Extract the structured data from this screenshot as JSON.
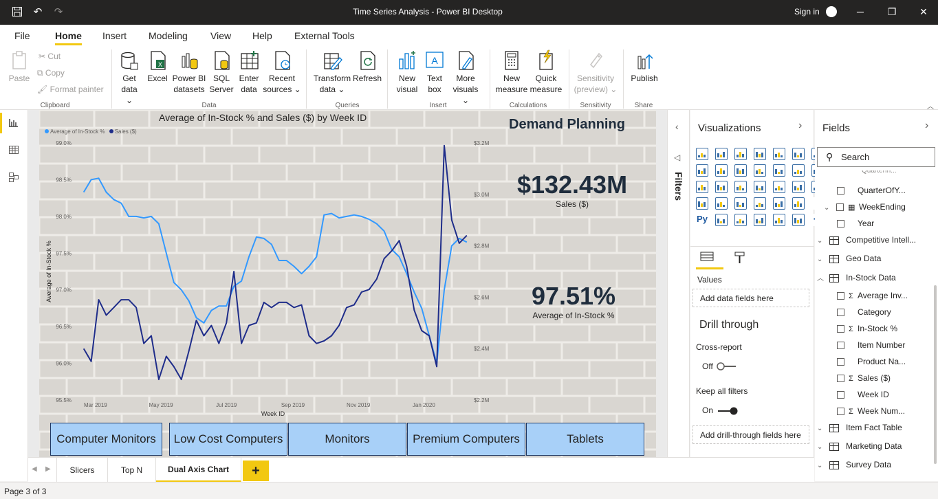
{
  "window": {
    "title": "Time Series Analysis - Power BI Desktop",
    "sign_in": "Sign in"
  },
  "menu": [
    "File",
    "Home",
    "Insert",
    "Modeling",
    "View",
    "Help",
    "External Tools"
  ],
  "ribbon": {
    "clipboard": {
      "paste": "Paste",
      "cut": "Cut",
      "copy": "Copy",
      "format_painter": "Format painter",
      "group": "Clipboard"
    },
    "data": {
      "get_data": [
        "Get",
        "data ⌄"
      ],
      "excel": "Excel",
      "pbi_datasets": [
        "Power BI",
        "datasets"
      ],
      "sql": [
        "SQL",
        "Server"
      ],
      "enter_data": [
        "Enter",
        "data"
      ],
      "recent": [
        "Recent",
        "sources ⌄"
      ],
      "group": "Data"
    },
    "queries": {
      "transform": [
        "Transform",
        "data ⌄"
      ],
      "refresh": "Refresh",
      "group": "Queries"
    },
    "insert": {
      "new_visual": [
        "New",
        "visual"
      ],
      "text_box": [
        "Text",
        "box"
      ],
      "more_visuals": [
        "More",
        "visuals ⌄"
      ],
      "group": "Insert"
    },
    "calculations": {
      "new_measure": [
        "New",
        "measure"
      ],
      "quick_measure": [
        "Quick",
        "measure"
      ],
      "group": "Calculations"
    },
    "sensitivity": {
      "label": [
        "Sensitivity",
        "(preview) ⌄"
      ],
      "group": "Sensitivity"
    },
    "share": {
      "publish": "Publish",
      "group": "Share"
    }
  },
  "report": {
    "chart_title": "Average of In-Stock % and Sales ($) by Week ID",
    "heading": "Demand Planning",
    "kpi_sales": {
      "value": "$132.43M",
      "label": "Sales ($)"
    },
    "kpi_instock": {
      "value": "97.51%",
      "label": "Average of In-Stock %"
    },
    "slicers": [
      "Computer Monitors",
      "Low Cost Computers",
      "Monitors",
      "Premium Computers",
      "Tablets"
    ]
  },
  "chart_data": {
    "type": "line",
    "title": "Average of In-Stock % and Sales ($) by Week ID",
    "xlabel": "Week ID",
    "ylabel": "Average of In-Stock %",
    "x_ticks": [
      "Mar 2019",
      "May 2019",
      "Jul 2019",
      "Sep 2019",
      "Nov 2019",
      "Jan 2020"
    ],
    "y_ticks": [
      "99.0%",
      "98.5%",
      "98.0%",
      "97.5%",
      "97.0%",
      "96.5%",
      "96.0%",
      "95.5%"
    ],
    "y2_ticks": [
      "$3.2M",
      "$3.0M",
      "$2.8M",
      "$2.6M",
      "$2.4M",
      "$2.2M"
    ],
    "ylim": [
      95.5,
      99.0
    ],
    "y2lim": [
      2.2,
      3.2
    ],
    "legend_position": "top-left",
    "series": [
      {
        "name": "Average of In-Stock %",
        "axis": "left",
        "color": "#3399ff",
        "x": [
          "2019-02-18",
          "2019-02-25",
          "2019-03-04",
          "2019-03-11",
          "2019-03-18",
          "2019-03-25",
          "2019-04-01",
          "2019-04-08",
          "2019-04-15",
          "2019-04-22",
          "2019-04-29",
          "2019-05-06",
          "2019-05-13",
          "2019-05-20",
          "2019-05-27",
          "2019-06-03",
          "2019-06-10",
          "2019-06-17",
          "2019-06-24",
          "2019-07-01",
          "2019-07-08",
          "2019-07-15",
          "2019-07-22",
          "2019-07-29",
          "2019-08-05",
          "2019-08-12",
          "2019-08-19",
          "2019-08-26",
          "2019-09-02",
          "2019-09-09",
          "2019-09-16",
          "2019-09-23",
          "2019-09-30",
          "2019-10-07",
          "2019-10-14",
          "2019-10-21",
          "2019-10-28",
          "2019-11-04",
          "2019-11-11",
          "2019-11-18",
          "2019-11-25",
          "2019-12-02",
          "2019-12-09",
          "2019-12-16",
          "2019-12-23",
          "2019-12-30",
          "2020-01-06",
          "2020-01-13",
          "2020-01-20",
          "2020-01-27",
          "2020-02-03",
          "2020-02-10"
        ],
        "y": [
          98.33,
          98.5,
          98.52,
          98.33,
          98.23,
          98.18,
          98.0,
          98.0,
          97.98,
          98.0,
          97.9,
          97.5,
          97.1,
          97.0,
          96.85,
          96.62,
          96.55,
          96.72,
          96.78,
          96.78,
          97.05,
          97.12,
          97.45,
          97.72,
          97.7,
          97.62,
          97.4,
          97.4,
          97.32,
          97.22,
          97.32,
          97.45,
          98.02,
          98.04,
          97.98,
          98.0,
          98.02,
          98.0,
          97.96,
          97.9,
          97.8,
          97.55,
          97.45,
          97.22,
          96.97,
          96.75,
          96.38,
          96.0,
          97.0,
          97.6,
          97.7,
          97.65
        ]
      },
      {
        "name": "Sales ($)",
        "axis": "right",
        "color": "#1f2d8a",
        "x": [
          "2019-02-18",
          "2019-02-25",
          "2019-03-04",
          "2019-03-11",
          "2019-03-18",
          "2019-03-25",
          "2019-04-01",
          "2019-04-08",
          "2019-04-15",
          "2019-04-22",
          "2019-04-29",
          "2019-05-06",
          "2019-05-13",
          "2019-05-20",
          "2019-05-27",
          "2019-06-03",
          "2019-06-10",
          "2019-06-17",
          "2019-06-24",
          "2019-07-01",
          "2019-07-08",
          "2019-07-15",
          "2019-07-22",
          "2019-07-29",
          "2019-08-05",
          "2019-08-12",
          "2019-08-19",
          "2019-08-26",
          "2019-09-02",
          "2019-09-09",
          "2019-09-16",
          "2019-09-23",
          "2019-09-30",
          "2019-10-07",
          "2019-10-14",
          "2019-10-21",
          "2019-10-28",
          "2019-11-04",
          "2019-11-11",
          "2019-11-18",
          "2019-11-25",
          "2019-12-02",
          "2019-12-09",
          "2019-12-16",
          "2019-12-23",
          "2019-12-30",
          "2020-01-06",
          "2020-01-13",
          "2020-01-20",
          "2020-01-27",
          "2020-02-03",
          "2020-02-10"
        ],
        "y": [
          2.4,
          2.35,
          2.59,
          2.53,
          2.56,
          2.59,
          2.59,
          2.56,
          2.42,
          2.45,
          2.28,
          2.37,
          2.33,
          2.28,
          2.39,
          2.51,
          2.45,
          2.49,
          2.42,
          2.5,
          2.7,
          2.42,
          2.49,
          2.5,
          2.58,
          2.56,
          2.58,
          2.58,
          2.56,
          2.57,
          2.45,
          2.42,
          2.43,
          2.45,
          2.49,
          2.56,
          2.57,
          2.62,
          2.63,
          2.67,
          2.75,
          2.78,
          2.82,
          2.72,
          2.55,
          2.47,
          2.45,
          2.33,
          3.19,
          2.9,
          2.81,
          2.84
        ]
      }
    ]
  },
  "filters": {
    "label": "Filters"
  },
  "visualizations": {
    "title": "Visualizations",
    "icons": [
      "stacked-bar",
      "stacked-column",
      "clustered-bar",
      "clustered-column",
      "100-bar",
      "100-column",
      "line",
      "area",
      "stacked-area",
      "line-column",
      "line-clustered",
      "ribbon",
      "waterfall",
      "funnel",
      "scatter",
      "pie",
      "donut",
      "treemap",
      "map",
      "filled-map",
      "gauge",
      "card",
      "multi-row-card",
      "kpi",
      "slicer",
      "table",
      "matrix",
      "R",
      "Py",
      "key-influencers",
      "decomp-tree",
      "qa",
      "smart-narrative",
      "paginated",
      "more"
    ],
    "icon_labels": {
      "R": "R",
      "Py": "Py",
      "more": "···"
    },
    "values_label": "Values",
    "add_data_fields": "Add data fields here",
    "drill_through": "Drill through",
    "cross_report": "Cross-report",
    "cross_report_state": "Off",
    "keep_all_filters": "Keep all filters",
    "keep_filters_state": "On",
    "add_drill_fields": "Add drill-through fields here"
  },
  "fields": {
    "title": "Fields",
    "search_placeholder": "Search",
    "items": [
      {
        "label": "QuarterOfY...",
        "kind": "field"
      },
      {
        "label": "WeekEnding",
        "kind": "hierarchy"
      },
      {
        "label": "Year",
        "kind": "field"
      },
      {
        "label": "Competitive Intell...",
        "kind": "table"
      },
      {
        "label": "Geo Data",
        "kind": "table"
      },
      {
        "label": "In-Stock Data",
        "kind": "table-open"
      },
      {
        "label": "Average Inv...",
        "kind": "sum"
      },
      {
        "label": "Category",
        "kind": "field"
      },
      {
        "label": "In-Stock %",
        "kind": "sum"
      },
      {
        "label": "Item Number",
        "kind": "field"
      },
      {
        "label": "Product Na...",
        "kind": "field"
      },
      {
        "label": "Sales ($)",
        "kind": "sum"
      },
      {
        "label": "Week ID",
        "kind": "field"
      },
      {
        "label": "Week Num...",
        "kind": "sum"
      },
      {
        "label": "Item Fact Table",
        "kind": "table"
      },
      {
        "label": "Marketing Data",
        "kind": "table"
      },
      {
        "label": "Survey Data",
        "kind": "table"
      }
    ]
  },
  "tabs": [
    "Slicers",
    "Top N",
    "Dual Axis Chart"
  ],
  "status": "Page 3 of 3"
}
